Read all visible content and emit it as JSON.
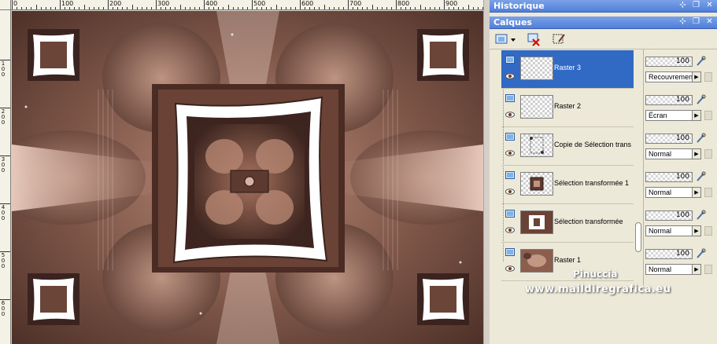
{
  "ruler": {
    "top_labels": [
      "0",
      "100",
      "200",
      "300",
      "400",
      "500",
      "600",
      "700",
      "800",
      "900"
    ],
    "left_labels": [
      "100",
      "200",
      "300",
      "400",
      "500",
      "600"
    ]
  },
  "panels": {
    "history_title": "Historique",
    "layers_title": "Calques"
  },
  "layers": [
    {
      "name": "Raster 3",
      "opacity": "100",
      "blend": "Recouvrement",
      "active": true
    },
    {
      "name": "Raster 2",
      "opacity": "100",
      "blend": "Écran",
      "active": false
    },
    {
      "name": "Copie de Sélection trans",
      "opacity": "100",
      "blend": "Normal",
      "active": false
    },
    {
      "name": "Sélection transformée 1",
      "opacity": "100",
      "blend": "Normal",
      "active": false
    },
    {
      "name": "Sélection transformée",
      "opacity": "100",
      "blend": "Normal",
      "active": false
    },
    {
      "name": "Raster 1",
      "opacity": "100",
      "blend": "Normal",
      "active": false
    }
  ],
  "watermark": {
    "line1": "Pinuccia",
    "line2": "www.maildiregrafica.eu"
  },
  "icons": {
    "new-layer": "new-layer-icon",
    "delete": "delete-layer-icon",
    "mask": "mask-icon",
    "eye": "eye-icon",
    "brush": "brush-icon"
  },
  "colors": {
    "title_bar": "#4f7fd9",
    "selected_row": "#316ac5",
    "panel_bg": "#ece9d8",
    "canvas_brown": "#6d4a3f"
  }
}
